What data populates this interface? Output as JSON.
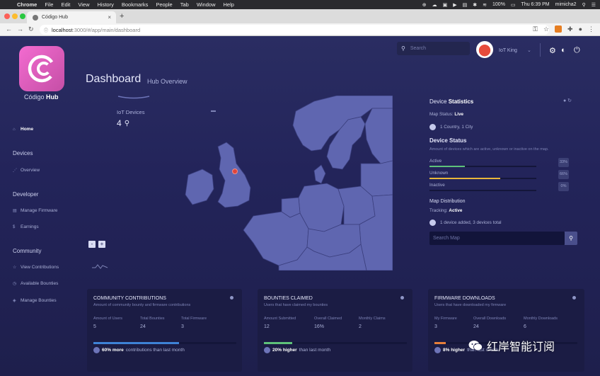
{
  "menubar": {
    "app": "Chrome",
    "items": [
      "File",
      "Edit",
      "View",
      "History",
      "Bookmarks",
      "People",
      "Tab",
      "Window",
      "Help"
    ],
    "battery": "100%",
    "clock": "Thu 6:39 PM",
    "user": "mimicha2"
  },
  "browser": {
    "tab_title": "Código Hub",
    "url_host": "localhost",
    "url_path": ":3000/#/app/main/dashboard"
  },
  "brand": {
    "name": "Código",
    "bold": "Hub"
  },
  "sidebar": {
    "home": "Home",
    "sections": [
      {
        "title": "Devices",
        "items": [
          "Overview"
        ]
      },
      {
        "title": "Developer",
        "items": [
          "Manage Firmware",
          "Earnings"
        ]
      },
      {
        "title": "Community",
        "items": [
          "View Contributions",
          "Available Bounties",
          "Manage Bounties"
        ]
      }
    ]
  },
  "header": {
    "title": "Dashboard",
    "subtitle": "Hub Overview",
    "search_placeholder": "Search",
    "user_name": "IoT King"
  },
  "iot": {
    "label": "IoT Devices",
    "value": "4"
  },
  "map": {
    "zoom_out": "-",
    "zoom_in": "+"
  },
  "stats": {
    "title_light": "Device",
    "title_bold": "Statistics",
    "map_status_label": "Map Status:",
    "map_status": "Live",
    "location": "1 Country, 1 City",
    "status_title": "Device Status",
    "status_desc": "Amount of devices which are active, unknown or inactive on the map.",
    "rows": [
      {
        "label": "Active",
        "pct": "33%",
        "value": 0.33,
        "color": "#5ec27a"
      },
      {
        "label": "Unknown",
        "pct": "66%",
        "value": 0.66,
        "color": "#e8b73a"
      },
      {
        "label": "Inactive",
        "pct": "0%",
        "value": 0.0,
        "color": "#8e95c6"
      }
    ],
    "distribution_title": "Map Distribution",
    "tracking_label": "Tracking:",
    "tracking": "Active",
    "added": "1 device added, 3 devices total",
    "map_search_placeholder": "Search Map"
  },
  "cards": [
    {
      "title": "COMMUNITY CONTRIBUTIONS",
      "subtitle": "Amount of community bounty and firmware contributions",
      "stats": [
        {
          "label": "Amount of Users",
          "value": "5"
        },
        {
          "label": "Total Bounties",
          "value": "24"
        },
        {
          "label": "Total Firmware",
          "value": "3"
        }
      ],
      "progress": 0.6,
      "color": "#3e82d6",
      "foot_bold": "60% more",
      "foot_rest": "contributions than last month"
    },
    {
      "title": "BOUNTIES CLAIMED",
      "subtitle": "Users that have claimed my bounties",
      "stats": [
        {
          "label": "Amount Submitted",
          "value": "12"
        },
        {
          "label": "Overall Claimed",
          "value": "16%"
        },
        {
          "label": "Monthly Claims",
          "value": "2"
        }
      ],
      "progress": 0.2,
      "color": "#5ec27a",
      "foot_bold": "20% higher",
      "foot_rest": "than last month"
    },
    {
      "title": "FIRMWARE DOWNLOADS",
      "subtitle": "Users that have downloaded my firmware",
      "stats": [
        {
          "label": "My Firmware",
          "value": "3"
        },
        {
          "label": "Overall Downloads",
          "value": "24"
        },
        {
          "label": "Monthly Downloads",
          "value": "6"
        }
      ],
      "progress": 0.08,
      "color": "#e67e3a",
      "foot_bold": "8% higher",
      "foot_rest": "than last month"
    }
  ],
  "watermark": "红岸智能订阅"
}
